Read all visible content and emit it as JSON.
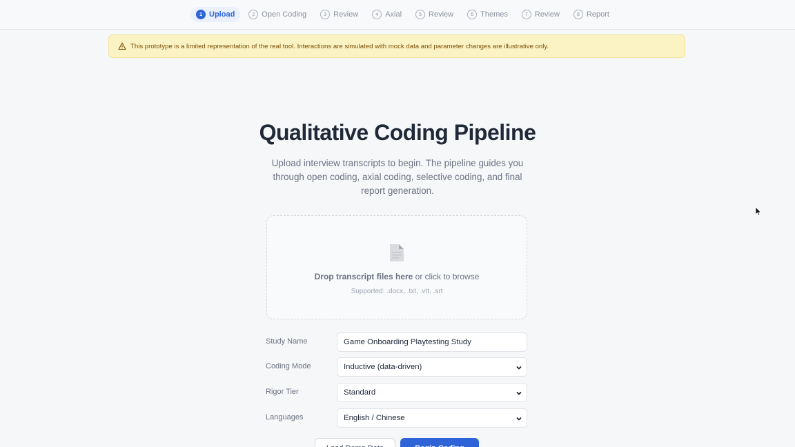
{
  "stepper": {
    "steps": [
      {
        "num": "1",
        "label": "Upload",
        "active": true
      },
      {
        "num": "2",
        "label": "Open Coding"
      },
      {
        "num": "3",
        "label": "Review"
      },
      {
        "num": "4",
        "label": "Axial"
      },
      {
        "num": "5",
        "label": "Review"
      },
      {
        "num": "6",
        "label": "Themes"
      },
      {
        "num": "7",
        "label": "Review"
      },
      {
        "num": "8",
        "label": "Report"
      }
    ]
  },
  "banner": {
    "icon": "warning-triangle-icon",
    "text": "This prototype is a limited representation of the real tool. Interactions are simulated with mock data and parameter changes are illustrative only."
  },
  "header": {
    "title": "Qualitative Coding Pipeline",
    "subtitle": "Upload interview transcripts to begin. The pipeline guides you through open coding, axial coding, selective coding, and final report generation."
  },
  "dropzone": {
    "icon": "file-icon",
    "strong_text": "Drop transcript files here",
    "rest_text": " or click to browse",
    "supported": "Supported: .docx, .txt, .vtt, .srt"
  },
  "form": {
    "study_name": {
      "label": "Study Name",
      "value": "Game Onboarding Playtesting Study"
    },
    "coding_mode": {
      "label": "Coding Mode",
      "value": "Inductive (data-driven)"
    },
    "rigor_tier": {
      "label": "Rigor Tier",
      "value": "Standard"
    },
    "languages": {
      "label": "Languages",
      "value": "English / Chinese"
    }
  },
  "buttons": {
    "secondary": "Load Demo Data",
    "primary": "Begin Coding"
  },
  "colors": {
    "accent": "#2f64d8",
    "banner_bg": "#fbf3c3",
    "banner_text": "#7a4d08"
  }
}
